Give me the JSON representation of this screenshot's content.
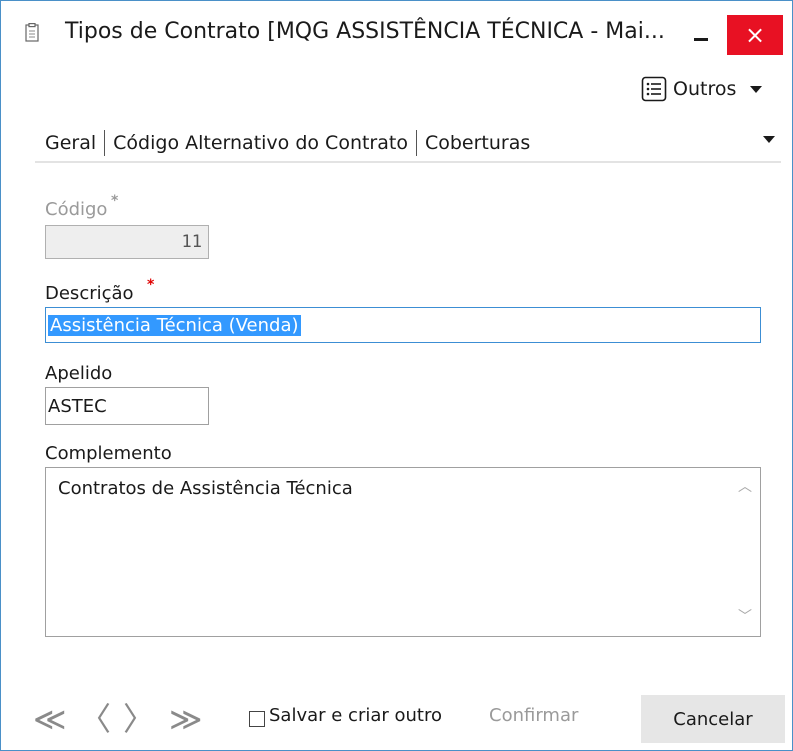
{
  "window": {
    "title": "Tipos de Contrato [MQG ASSISTÊNCIA TÉCNICA - Mai...",
    "close_glyph": "×"
  },
  "toolbar": {
    "outros_label": "Outros",
    "icon": "list-icon"
  },
  "tabs": [
    {
      "label": "Geral",
      "active": true
    },
    {
      "label": "Código Alternativo do Contrato",
      "active": false
    },
    {
      "label": "Coberturas",
      "active": false
    }
  ],
  "form": {
    "codigo": {
      "label": "Código",
      "required_mark": "*",
      "value": "11",
      "disabled": true
    },
    "descricao": {
      "label": "Descrição",
      "required_mark": "*",
      "value": "Assistência Técnica (Venda)"
    },
    "apelido": {
      "label": "Apelido",
      "value": "ASTEC"
    },
    "complemento": {
      "label": "Complemento",
      "value": "Contratos de Assistência Técnica"
    }
  },
  "footer": {
    "nav_first": "≪",
    "nav_prev": "〈",
    "nav_next": "〉",
    "nav_last": "≫",
    "save_and_new_label": "Salvar e criar outro",
    "save_and_new_checked": false,
    "confirm_label": "Confirmar",
    "cancel_label": "Cancelar"
  },
  "colors": {
    "close_button": "#e81123",
    "selection": "#3399ff",
    "required_active": "#e00000",
    "required_disabled": "#9a9a9a"
  }
}
